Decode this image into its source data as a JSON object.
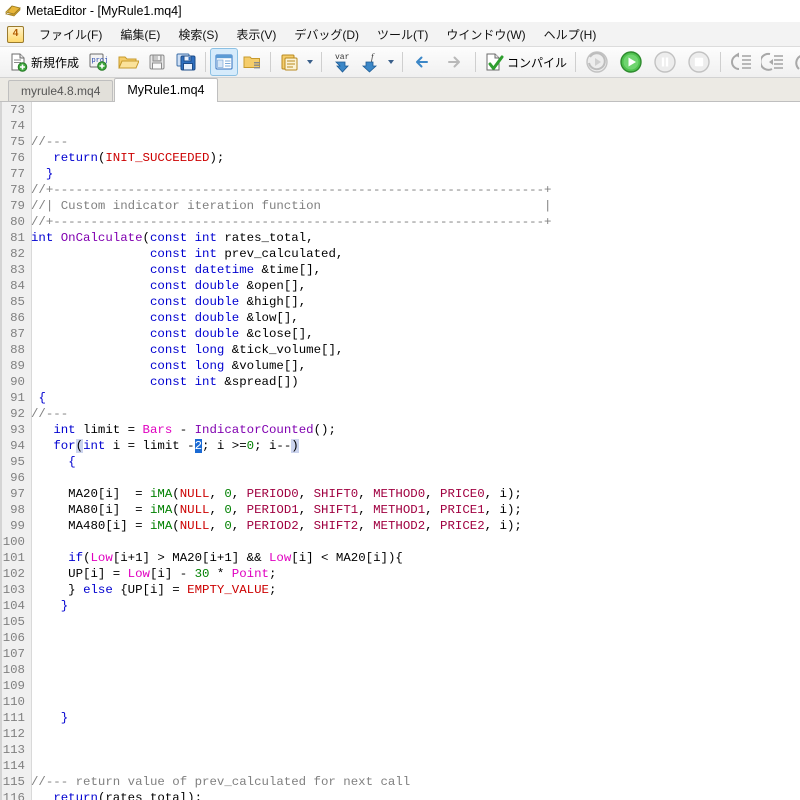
{
  "window": {
    "title": "MetaEditor - [MyRule1.mq4]",
    "icon": "metaeditor-logo-icon"
  },
  "menubar": {
    "badge": "4",
    "items": [
      {
        "label": "ファイル(F)",
        "name": "menu-file"
      },
      {
        "label": "編集(E)",
        "name": "menu-edit"
      },
      {
        "label": "検索(S)",
        "name": "menu-search"
      },
      {
        "label": "表示(V)",
        "name": "menu-view"
      },
      {
        "label": "デバッグ(D)",
        "name": "menu-debug"
      },
      {
        "label": "ツール(T)",
        "name": "menu-tools"
      },
      {
        "label": "ウインドウ(W)",
        "name": "menu-window"
      },
      {
        "label": "ヘルプ(H)",
        "name": "menu-help"
      }
    ]
  },
  "toolbar": {
    "new_label": "新規作成",
    "compile_label": "コンパイル",
    "icons": {
      "new_file": "new-document-icon",
      "new_project": "new-project-icon",
      "open": "open-folder-icon",
      "save": "save-disk-icon",
      "save_all": "save-all-disk-icon",
      "navigator": "navigator-panel-icon",
      "toolbox": "toolbox-panel-icon",
      "clipboard": "clipboard-insert-icon",
      "variable": "insert-variable-icon",
      "function": "insert-function-icon",
      "back": "navigate-back-arrow-icon",
      "forward": "navigate-forward-arrow-icon",
      "compile": "compile-check-icon",
      "restart": "debug-restart-icon",
      "run": "debug-run-icon",
      "pause": "debug-pause-icon",
      "stop": "debug-stop-icon",
      "step_into": "step-into-icon",
      "step_over": "step-over-icon",
      "step_out": "step-out-icon"
    }
  },
  "tabs": {
    "items": [
      {
        "label": "myrule4.8.mq4",
        "selected": false,
        "name": "tab-myrule48"
      },
      {
        "label": "MyRule1.mq4",
        "selected": true,
        "name": "tab-myrule1"
      }
    ]
  },
  "editor": {
    "first_line": 73,
    "selection": "2",
    "lines": [
      {
        "n": 73,
        "t": []
      },
      {
        "n": 74,
        "t": []
      },
      {
        "n": 75,
        "t": [
          [
            "cmt",
            "//---"
          ]
        ]
      },
      {
        "n": 76,
        "t": [
          [
            "plain",
            "   "
          ],
          [
            "kw",
            "return"
          ],
          [
            "plain",
            "("
          ],
          [
            "const",
            "INIT_SUCCEEDED"
          ],
          [
            "plain",
            ");"
          ]
        ]
      },
      {
        "n": 77,
        "t": [
          [
            "plain",
            "  "
          ],
          [
            "kw",
            "}"
          ]
        ]
      },
      {
        "n": 78,
        "t": [
          [
            "cmt",
            "//+------------------------------------------------------------------+"
          ]
        ]
      },
      {
        "n": 79,
        "t": [
          [
            "cmt",
            "//| Custom indicator iteration function                              |"
          ]
        ]
      },
      {
        "n": 80,
        "t": [
          [
            "cmt",
            "//+------------------------------------------------------------------+"
          ]
        ]
      },
      {
        "n": 81,
        "t": [
          [
            "kw",
            "int"
          ],
          [
            "plain",
            " "
          ],
          [
            "fn",
            "OnCalculate"
          ],
          [
            "plain",
            "("
          ],
          [
            "kw",
            "const int"
          ],
          [
            "plain",
            " rates_total,"
          ]
        ]
      },
      {
        "n": 82,
        "t": [
          [
            "plain",
            "                "
          ],
          [
            "kw",
            "const int"
          ],
          [
            "plain",
            " prev_calculated,"
          ]
        ]
      },
      {
        "n": 83,
        "t": [
          [
            "plain",
            "                "
          ],
          [
            "kw",
            "const datetime"
          ],
          [
            "plain",
            " &time[],"
          ]
        ]
      },
      {
        "n": 84,
        "t": [
          [
            "plain",
            "                "
          ],
          [
            "kw",
            "const double"
          ],
          [
            "plain",
            " &open[],"
          ]
        ]
      },
      {
        "n": 85,
        "t": [
          [
            "plain",
            "                "
          ],
          [
            "kw",
            "const double"
          ],
          [
            "plain",
            " &high[],"
          ]
        ]
      },
      {
        "n": 86,
        "t": [
          [
            "plain",
            "                "
          ],
          [
            "kw",
            "const double"
          ],
          [
            "plain",
            " &low[],"
          ]
        ]
      },
      {
        "n": 87,
        "t": [
          [
            "plain",
            "                "
          ],
          [
            "kw",
            "const double"
          ],
          [
            "plain",
            " &close[],"
          ]
        ]
      },
      {
        "n": 88,
        "t": [
          [
            "plain",
            "                "
          ],
          [
            "kw",
            "const long"
          ],
          [
            "plain",
            " &tick_volume[],"
          ]
        ]
      },
      {
        "n": 89,
        "t": [
          [
            "plain",
            "                "
          ],
          [
            "kw",
            "const long"
          ],
          [
            "plain",
            " &volume[],"
          ]
        ]
      },
      {
        "n": 90,
        "t": [
          [
            "plain",
            "                "
          ],
          [
            "kw",
            "const int"
          ],
          [
            "plain",
            " &spread[])"
          ]
        ]
      },
      {
        "n": 91,
        "t": [
          [
            "plain",
            " "
          ],
          [
            "kw",
            "{"
          ]
        ]
      },
      {
        "n": 92,
        "t": [
          [
            "cmt",
            "//---"
          ]
        ]
      },
      {
        "n": 93,
        "t": [
          [
            "plain",
            "   "
          ],
          [
            "kw",
            "int"
          ],
          [
            "plain",
            " limit = "
          ],
          [
            "pred",
            "Bars"
          ],
          [
            "plain",
            " - "
          ],
          [
            "fn",
            "IndicatorCounted"
          ],
          [
            "plain",
            "();"
          ]
        ]
      },
      {
        "n": 94,
        "t": [
          [
            "plain",
            "   "
          ],
          [
            "kw",
            "for"
          ],
          [
            "brk",
            "("
          ],
          [
            "kw",
            "int"
          ],
          [
            "plain",
            " i = limit -"
          ],
          [
            "sel",
            "2"
          ],
          [
            "plain",
            "; i >="
          ],
          [
            "num",
            "0"
          ],
          [
            "plain",
            "; i--"
          ],
          [
            "brk",
            ")"
          ]
        ]
      },
      {
        "n": 95,
        "t": [
          [
            "plain",
            "     "
          ],
          [
            "kw",
            "{"
          ]
        ]
      },
      {
        "n": 96,
        "t": []
      },
      {
        "n": 97,
        "t": [
          [
            "plain",
            "     MA20[i]  = "
          ],
          [
            "bi",
            "iMA"
          ],
          [
            "plain",
            "("
          ],
          [
            "const",
            "NULL"
          ],
          [
            "plain",
            ", "
          ],
          [
            "num",
            "0"
          ],
          [
            "plain",
            ", "
          ],
          [
            "prop",
            "PERIOD0"
          ],
          [
            "plain",
            ", "
          ],
          [
            "prop",
            "SHIFT0"
          ],
          [
            "plain",
            ", "
          ],
          [
            "prop",
            "METHOD0"
          ],
          [
            "plain",
            ", "
          ],
          [
            "prop",
            "PRICE0"
          ],
          [
            "plain",
            ", i);"
          ]
        ]
      },
      {
        "n": 98,
        "t": [
          [
            "plain",
            "     MA80[i]  = "
          ],
          [
            "bi",
            "iMA"
          ],
          [
            "plain",
            "("
          ],
          [
            "const",
            "NULL"
          ],
          [
            "plain",
            ", "
          ],
          [
            "num",
            "0"
          ],
          [
            "plain",
            ", "
          ],
          [
            "prop",
            "PERIOD1"
          ],
          [
            "plain",
            ", "
          ],
          [
            "prop",
            "SHIFT1"
          ],
          [
            "plain",
            ", "
          ],
          [
            "prop",
            "METHOD1"
          ],
          [
            "plain",
            ", "
          ],
          [
            "prop",
            "PRICE1"
          ],
          [
            "plain",
            ", i);"
          ]
        ]
      },
      {
        "n": 99,
        "t": [
          [
            "plain",
            "     MA480[i] = "
          ],
          [
            "bi",
            "iMA"
          ],
          [
            "plain",
            "("
          ],
          [
            "const",
            "NULL"
          ],
          [
            "plain",
            ", "
          ],
          [
            "num",
            "0"
          ],
          [
            "plain",
            ", "
          ],
          [
            "prop",
            "PERIOD2"
          ],
          [
            "plain",
            ", "
          ],
          [
            "prop",
            "SHIFT2"
          ],
          [
            "plain",
            ", "
          ],
          [
            "prop",
            "METHOD2"
          ],
          [
            "plain",
            ", "
          ],
          [
            "prop",
            "PRICE2"
          ],
          [
            "plain",
            ", i);"
          ]
        ]
      },
      {
        "n": 100,
        "t": []
      },
      {
        "n": 101,
        "t": [
          [
            "plain",
            "     "
          ],
          [
            "kw",
            "if"
          ],
          [
            "plain",
            "("
          ],
          [
            "pred",
            "Low"
          ],
          [
            "plain",
            "[i+1] > MA20[i+1] && "
          ],
          [
            "pred",
            "Low"
          ],
          [
            "plain",
            "[i] < MA20[i]){"
          ]
        ]
      },
      {
        "n": 102,
        "t": [
          [
            "plain",
            "     UP[i] = "
          ],
          [
            "pred",
            "Low"
          ],
          [
            "plain",
            "[i] - "
          ],
          [
            "num",
            "30"
          ],
          [
            "plain",
            " * "
          ],
          [
            "pred",
            "Point"
          ],
          [
            "plain",
            ";"
          ]
        ]
      },
      {
        "n": 103,
        "t": [
          [
            "plain",
            "     } "
          ],
          [
            "kw",
            "else"
          ],
          [
            "plain",
            " {UP[i] = "
          ],
          [
            "const",
            "EMPTY_VALUE"
          ],
          [
            "plain",
            ";"
          ]
        ]
      },
      {
        "n": 104,
        "t": [
          [
            "plain",
            "    "
          ],
          [
            "kw",
            "}"
          ]
        ]
      },
      {
        "n": 105,
        "t": []
      },
      {
        "n": 106,
        "t": []
      },
      {
        "n": 107,
        "t": []
      },
      {
        "n": 108,
        "t": []
      },
      {
        "n": 109,
        "t": []
      },
      {
        "n": 110,
        "t": []
      },
      {
        "n": 111,
        "t": [
          [
            "plain",
            "    "
          ],
          [
            "kw",
            "}"
          ]
        ]
      },
      {
        "n": 112,
        "t": []
      },
      {
        "n": 113,
        "t": []
      },
      {
        "n": 114,
        "t": []
      },
      {
        "n": 115,
        "t": [
          [
            "cmt",
            "//--- return value of prev_calculated for next call"
          ]
        ]
      },
      {
        "n": 116,
        "t": [
          [
            "plain",
            "   "
          ],
          [
            "kw",
            "return"
          ],
          [
            "plain",
            "(rates_total);"
          ]
        ]
      }
    ]
  },
  "colors": {
    "keyword": "#0000d0",
    "comment": "#808080",
    "function": "#8000b0",
    "constant": "#cc0000",
    "number": "#008000",
    "property": "#a00040",
    "predefined": "#e000c0",
    "builtin": "#008000",
    "selection_bg": "#1a6ad4",
    "bracket_bg": "#ccd4ee",
    "gutter_bg": "#f0f0f0"
  }
}
